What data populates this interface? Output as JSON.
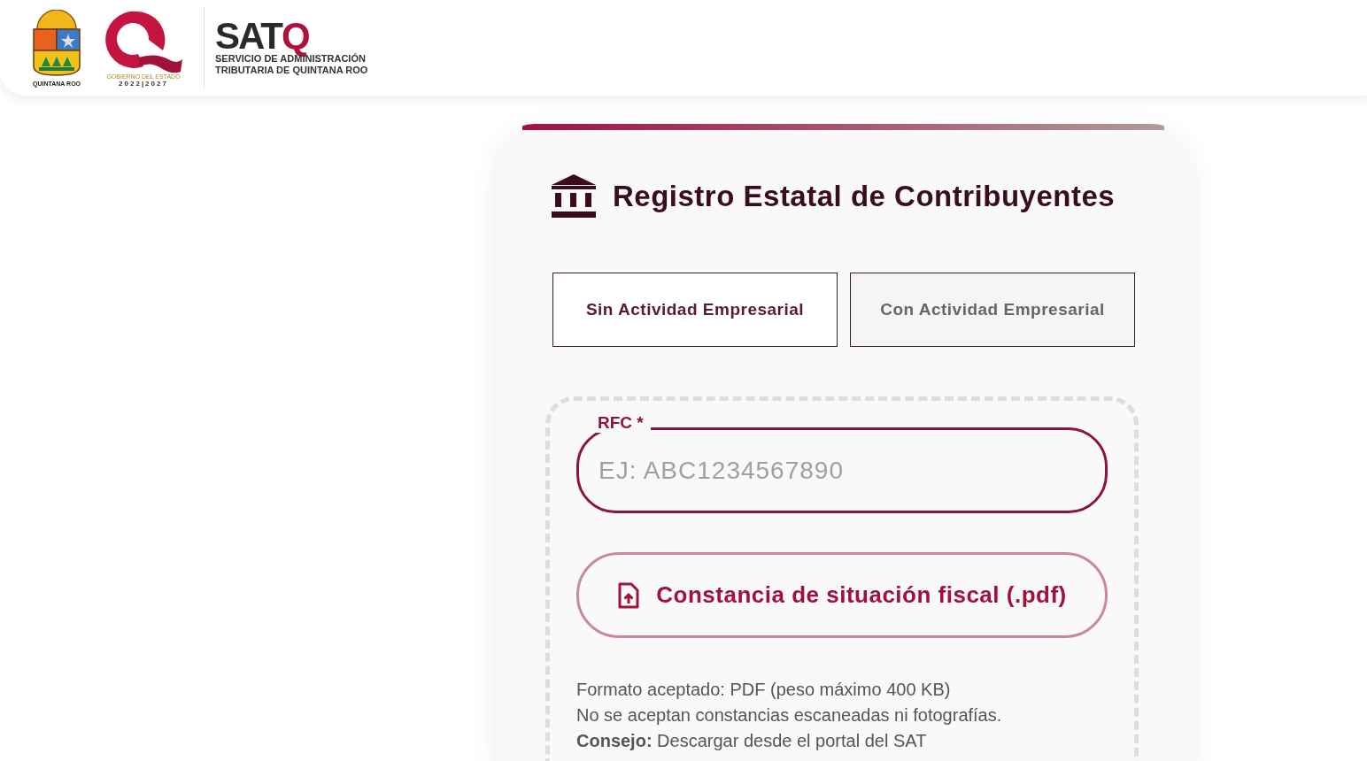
{
  "header": {
    "state_logo": {
      "caption": "QUINTANA ROO"
    },
    "government_logo": {
      "caption": "GOBIERNO DEL ESTADO",
      "years": "2022|2027"
    },
    "agency_logo": {
      "name": "SAT",
      "mark": "Q",
      "line_1": "SERVICIO DE ADMINISTRACIÓN",
      "line_2": "TRIBUTARIA DE QUINTANA ROO"
    }
  },
  "card": {
    "title": "Registro Estatal de Contribuyentes",
    "tabs": [
      {
        "label": "Sin Actividad Empresarial",
        "selected": true
      },
      {
        "label": "Con Actividad Empresarial",
        "selected": false
      }
    ],
    "rfc_field": {
      "label": "RFC *",
      "placeholder": "EJ: ABC1234567890"
    },
    "upload_button": {
      "label": "Constancia de situación fiscal (.pdf)"
    },
    "notes": [
      "Formato aceptado: PDF (peso máximo 400 KB)",
      "No se aceptan constancias escaneadas ni fotografías.",
      "**Consejo:** Descargar desde el portal del SAT"
    ]
  }
}
